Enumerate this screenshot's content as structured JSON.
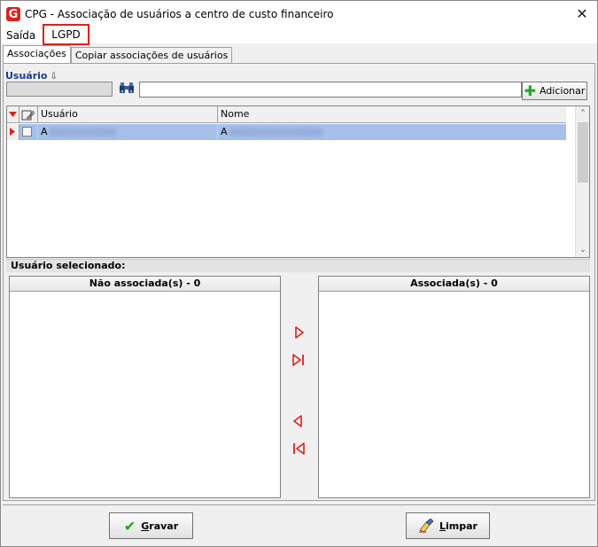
{
  "window": {
    "title": "CPG - Associação de usuários a centro de custo financeiro",
    "logo_letter": "G",
    "close_glyph": "✕"
  },
  "menu": {
    "items": [
      {
        "label": "Saída"
      },
      {
        "label": "LGPD"
      }
    ],
    "highlight_color": "#e0201a"
  },
  "tabs": [
    {
      "label": "Associações",
      "active": true
    },
    {
      "label": "Copiar associações de usuários",
      "active": false
    }
  ],
  "user_filter": {
    "label": "Usuário",
    "sort_glyph": "⇩",
    "code_value": "",
    "search_value": "",
    "add_button_label": "Adicionar",
    "binoculars_icon": "binoculars-icon",
    "add_icon": "plus-icon"
  },
  "grid": {
    "columns": [
      {
        "label": ""
      },
      {
        "label": ""
      },
      {
        "label": "Usuário"
      },
      {
        "label": "Nome"
      }
    ],
    "rows": [
      {
        "usuario_prefix": "A",
        "nome_prefix": "A",
        "selected": true
      }
    ],
    "selected_row_color": "#a6c0e9"
  },
  "selected_user": {
    "label": "Usuário selecionado:"
  },
  "lists": {
    "left_header": "Não associada(s) - 0",
    "right_header": "Associada(s) - 0"
  },
  "buttons": {
    "save_prefix": "G",
    "save_rest": "ravar",
    "clear_prefix": "L",
    "clear_rest": "impar"
  }
}
